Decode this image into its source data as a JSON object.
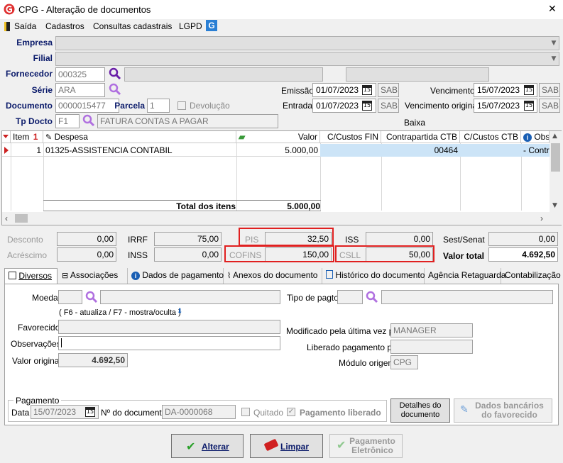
{
  "window": {
    "title": "CPG - Alteração de documentos",
    "close_glyph": "✕"
  },
  "menu": {
    "items": [
      "Saída",
      "Cadastros",
      "Consultas cadastrais",
      "LGPD"
    ]
  },
  "header": {
    "empresa_label": "Empresa",
    "filial_label": "Filial",
    "fornecedor_label": "Fornecedor",
    "fornecedor_code": "000325",
    "serie_label": "Série",
    "serie_value": "ARA",
    "emissao_label": "Emissão",
    "emissao_value": "01/07/2023",
    "emissao_day": "SAB",
    "vencimento_label": "Vencimento",
    "vencimento_value": "15/07/2023",
    "vencimento_day": "SAB",
    "documento_label": "Documento",
    "documento_value": "0000015477",
    "parcela_label": "Parcela",
    "parcela_value": "1",
    "devolucao_label": "Devolução",
    "entrada_label": "Entrada",
    "entrada_value": "01/07/2023",
    "entrada_day": "SAB",
    "venc_original_label": "Vencimento original",
    "venc_original_value": "15/07/2023",
    "venc_original_day": "SAB",
    "tpdocto_label": "Tp Docto",
    "tpdocto_code": "F1",
    "tpdocto_desc": "FATURA CONTAS A PAGAR",
    "baixa_label": "Baixa",
    "cal_glyph": "15"
  },
  "grid": {
    "columns": [
      "Item",
      "Despesa",
      "Valor",
      "C/Custos FIN",
      "Contrapartida CTB",
      "C/Custos CTB",
      "Obs"
    ],
    "sort_glyph": "1",
    "rows": [
      {
        "item": "1",
        "despesa": "01325-ASSISTENCIA CONTABIL",
        "valor": "5.000,00",
        "contrapartida": "00464",
        "obs": "- Contra"
      }
    ],
    "total_label": "Total dos itens",
    "total_value": "5.000,00"
  },
  "totals": {
    "desconto_label": "Desconto",
    "desconto_value": "0,00",
    "acrescimo_label": "Acréscimo",
    "acrescimo_value": "0,00",
    "irrf_label": "IRRF",
    "irrf_value": "75,00",
    "inss_label": "INSS",
    "inss_value": "0,00",
    "pis_label": "PIS",
    "pis_value": "32,50",
    "cofins_label": "COFINS",
    "cofins_value": "150,00",
    "iss_label": "ISS",
    "iss_value": "0,00",
    "csll_label": "CSLL",
    "csll_value": "50,00",
    "sestsenat_label": "Sest/Senat",
    "sestsenat_value": "0,00",
    "valortotal_label": "Valor total",
    "valortotal_value": "4.692,50",
    "highlight_color": "#e02020"
  },
  "tabs": [
    "Diversos",
    "Associações",
    "Dados de pagamento",
    "Anexos do documento",
    "Histórico do documento",
    "Agência Retaguarda",
    "Contabilização"
  ],
  "diversos": {
    "moeda_label": "Moeda",
    "tipo_pagto_label": "Tipo de pagto",
    "hint": "( F6 - atualiza / F7 - mostra/oculta )",
    "favorecido_label": "Favorecido",
    "observacoes_label": "Observações",
    "valor_original_label": "Valor original",
    "valor_original_value": "4.692,50",
    "modificado_label": "Modificado pela última vez por",
    "modificado_value": "MANAGER",
    "liberado_label": "Liberado pagamento por",
    "modulo_label": "Módulo origem",
    "modulo_value": "CPG"
  },
  "pagamento": {
    "group_label": "Pagamento",
    "data_label": "Data",
    "data_value": "15/07/2023",
    "ndoc_label": "Nº do documento",
    "ndoc_value": "DA-0000068",
    "quitado_label": "Quitado",
    "liberado_label": "Pagamento liberado",
    "detalhes_line1": "Detalhes do",
    "detalhes_line2": "documento",
    "bancarios_line1": "Dados bancários",
    "bancarios_line2": "do favorecido"
  },
  "footer": {
    "alterar_label": "Alterar",
    "limpar_label": "Limpar",
    "pagamento_line1": "Pagamento",
    "pagamento_line2": "Eletrônico"
  },
  "colors": {
    "accent": "#0a1a6a",
    "selection": "#cce4f7",
    "logo": "#e03030"
  }
}
